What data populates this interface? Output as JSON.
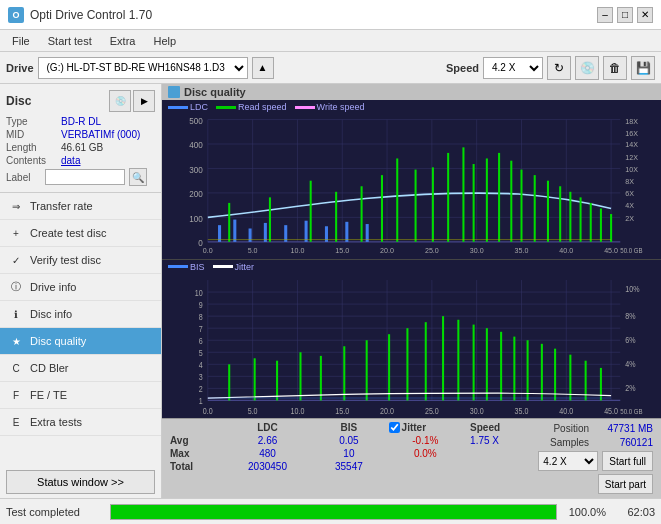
{
  "titleBar": {
    "title": "Opti Drive Control 1.70",
    "minimize": "–",
    "maximize": "□",
    "close": "✕"
  },
  "menuBar": {
    "items": [
      "File",
      "Start test",
      "Extra",
      "Help"
    ]
  },
  "toolbar": {
    "driveLabel": "Drive",
    "driveValue": "(G:)  HL-DT-ST BD-RE  WH16NS48 1.D3",
    "speedLabel": "Speed",
    "speedValue": "4.2 X"
  },
  "disc": {
    "title": "Disc",
    "type": {
      "label": "Type",
      "value": "BD-R DL"
    },
    "mid": {
      "label": "MID",
      "value": "VERBATIMf (000)"
    },
    "length": {
      "label": "Length",
      "value": "46.61 GB"
    },
    "contents": {
      "label": "Contents",
      "value": "data"
    },
    "labelField": {
      "label": "Label",
      "placeholder": ""
    }
  },
  "navItems": [
    {
      "id": "transfer-rate",
      "label": "Transfer rate",
      "icon": "→"
    },
    {
      "id": "create-test-disc",
      "label": "Create test disc",
      "icon": "+"
    },
    {
      "id": "verify-test-disc",
      "label": "Verify test disc",
      "icon": "✓"
    },
    {
      "id": "drive-info",
      "label": "Drive info",
      "icon": "i"
    },
    {
      "id": "disc-info",
      "label": "Disc info",
      "icon": "ℹ"
    },
    {
      "id": "disc-quality",
      "label": "Disc quality",
      "icon": "★",
      "active": true
    },
    {
      "id": "cd-bler",
      "label": "CD Bler",
      "icon": "C"
    },
    {
      "id": "fe-te",
      "label": "FE / TE",
      "icon": "F"
    },
    {
      "id": "extra-tests",
      "label": "Extra tests",
      "icon": "E"
    }
  ],
  "statusWindowBtn": "Status window >>",
  "chartTitle": "Disc quality",
  "chart1": {
    "legend": [
      "LDC",
      "Read speed",
      "Write speed"
    ],
    "yMax": 500,
    "yLabels": [
      "500",
      "400",
      "300",
      "200",
      "100",
      "0"
    ],
    "yRightLabels": [
      "18X",
      "16X",
      "14X",
      "12X",
      "10X",
      "8X",
      "6X",
      "4X",
      "2X"
    ],
    "xMax": 50,
    "xLabels": [
      "0.0",
      "5.0",
      "10.0",
      "15.0",
      "20.0",
      "25.0",
      "30.0",
      "35.0",
      "40.0",
      "45.0",
      "50.0 GB"
    ]
  },
  "chart2": {
    "legend": [
      "BIS",
      "Jitter"
    ],
    "yMax": 10,
    "yLabels": [
      "10",
      "9",
      "8",
      "7",
      "6",
      "5",
      "4",
      "3",
      "2",
      "1"
    ],
    "yRightLabels": [
      "10%",
      "8%",
      "6%",
      "4%",
      "2%"
    ],
    "xMax": 50,
    "xLabels": [
      "0.0",
      "5.0",
      "10.0",
      "15.0",
      "20.0",
      "25.0",
      "30.0",
      "35.0",
      "40.0",
      "45.0",
      "50.0 GB"
    ]
  },
  "stats": {
    "headers": [
      "",
      "LDC",
      "BIS",
      "",
      "Jitter",
      "Speed",
      "",
      ""
    ],
    "avg": {
      "label": "Avg",
      "ldc": "2.66",
      "bis": "0.05",
      "jitter": "-0.1%",
      "speed": "1.75 X"
    },
    "max": {
      "label": "Max",
      "ldc": "480",
      "bis": "10",
      "jitter": "0.0%"
    },
    "total": {
      "label": "Total",
      "ldc": "2030450",
      "bis": "35547"
    },
    "position": {
      "label": "Position",
      "value": "47731 MB"
    },
    "samples": {
      "label": "Samples",
      "value": "760121"
    },
    "speedSelect": "4.2 X",
    "startFull": "Start full",
    "startPart": "Start part"
  },
  "bottomBar": {
    "statusText": "Test completed",
    "progressPercent": 100,
    "progressText": "100.0%",
    "timeStart": "62:03"
  }
}
